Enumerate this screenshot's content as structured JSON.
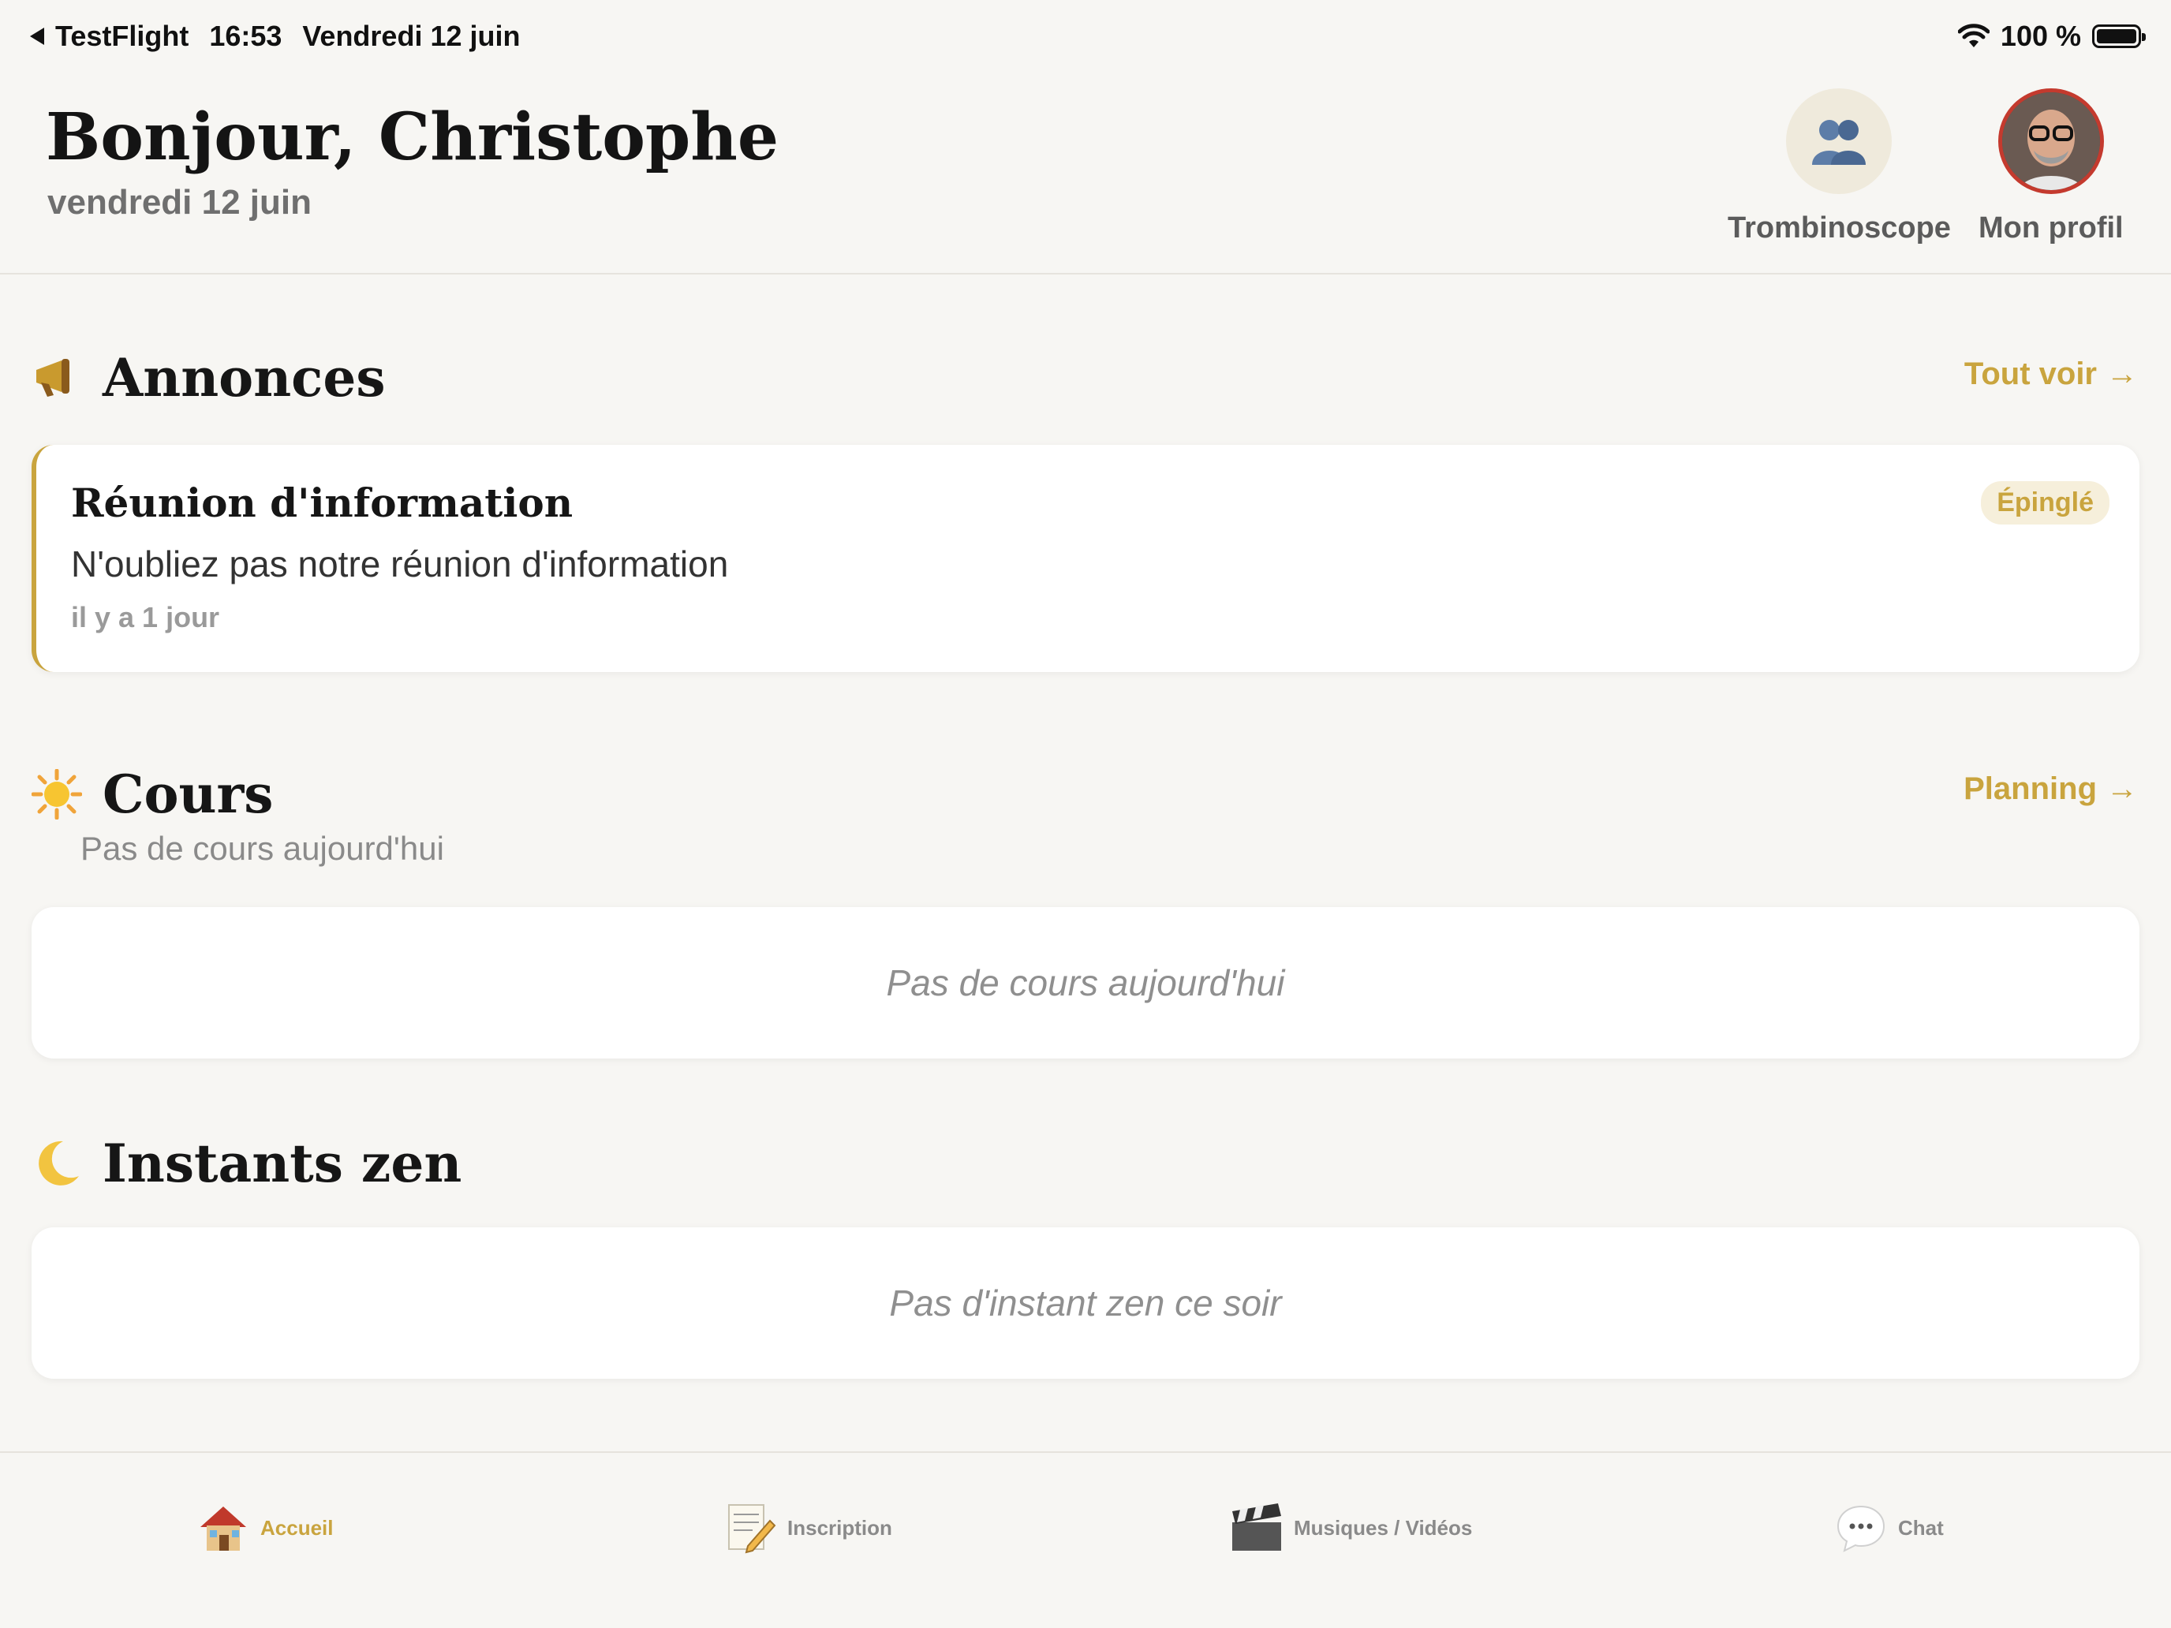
{
  "status_bar": {
    "back_app": "TestFlight",
    "time": "16:53",
    "date": "Vendredi 12 juin",
    "battery": "100 %"
  },
  "header": {
    "greeting": "Bonjour, Christophe",
    "date": "vendredi 12 juin",
    "trombinoscope_label": "Trombinoscope",
    "profile_label": "Mon profil"
  },
  "annonces": {
    "title": "Annonces",
    "link": "Tout voir",
    "items": [
      {
        "title": "Réunion d'information",
        "body": "N'oubliez pas notre réunion d'information",
        "time": "il y a 1 jour",
        "badge": "Épinglé"
      }
    ]
  },
  "cours": {
    "title": "Cours",
    "link": "Planning",
    "subtitle": "Pas de cours aujourd'hui",
    "empty": "Pas de cours aujourd'hui"
  },
  "zen": {
    "title": "Instants zen",
    "empty": "Pas d'instant zen ce soir"
  },
  "tabs": [
    {
      "label": "Accueil",
      "icon": "house-icon",
      "active": true
    },
    {
      "label": "Inscription",
      "icon": "memo-icon",
      "active": false
    },
    {
      "label": "Musiques / Vidéos",
      "icon": "clapper-icon",
      "active": false
    },
    {
      "label": "Chat",
      "icon": "chat-bubble-icon",
      "active": false
    }
  ],
  "colors": {
    "accent": "#c9a43e",
    "background": "#f7f6f3",
    "card": "#ffffff",
    "profile_ring": "#c43a2e"
  }
}
